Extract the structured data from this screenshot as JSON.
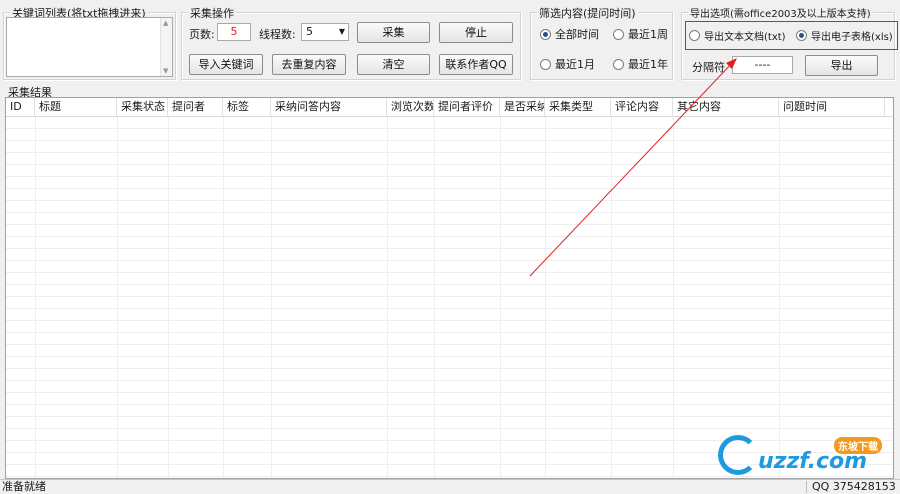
{
  "keywords": {
    "title": "关键词列表(将txt拖拽进来)",
    "value": ""
  },
  "collect": {
    "title": "采集操作",
    "pages_label": "页数:",
    "pages_value": "5",
    "threads_label": "线程数:",
    "threads_value": "5",
    "collect_btn": "采集",
    "stop_btn": "停止",
    "import_btn": "导入关键词",
    "dedupe_btn": "去重复内容",
    "clear_btn": "清空",
    "contact_btn": "联系作者QQ"
  },
  "filter": {
    "title": "筛选内容(提问时间)",
    "options": [
      "全部时间",
      "最近1周",
      "最近1月",
      "最近1年"
    ],
    "selected": "全部时间"
  },
  "export": {
    "title": "导出选项(需office2003及以上版本支持)",
    "option_text": "导出文本文档(txt)",
    "option_xls": "导出电子表格(xls)",
    "selected": "xls",
    "separator_label": "分隔符",
    "separator_value": "----",
    "export_btn": "导出"
  },
  "results": {
    "title": "采集结果",
    "columns": [
      "ID",
      "标题",
      "采集状态",
      "提问者",
      "标签",
      "采纳问答内容",
      "浏览次数",
      "提问者评价",
      "是否采纳",
      "采集类型",
      "评论内容",
      "其它内容",
      "问题时间"
    ]
  },
  "status": {
    "left": "准备就绪",
    "right": "QQ  375428153"
  },
  "watermark": {
    "brand": "uzzf.com",
    "badge": "东坡下载"
  },
  "colors": {
    "highlight_box": "#e02020",
    "annotation_arrow": "#e02020"
  }
}
